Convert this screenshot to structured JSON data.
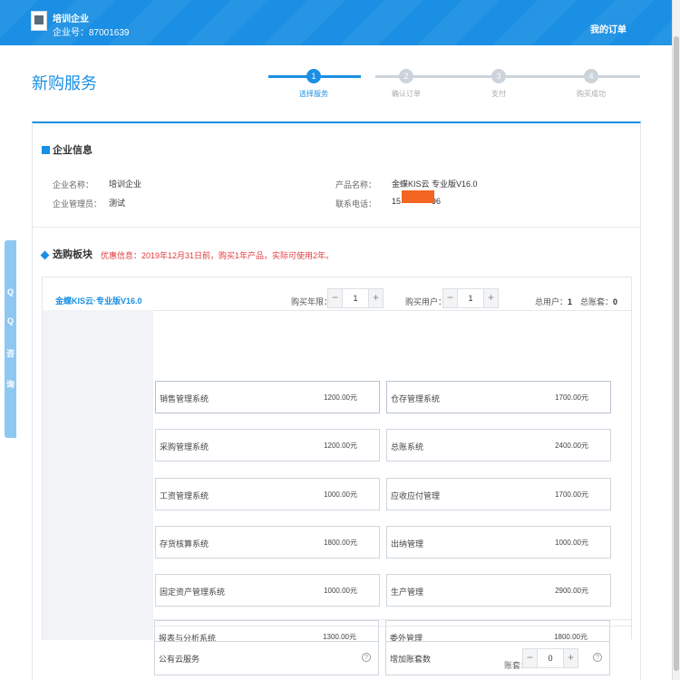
{
  "header": {
    "company_name": "培训企业",
    "company_no": "企业号：87001639",
    "my_orders": "我的订单"
  },
  "page": {
    "title": "新购服务"
  },
  "steps": [
    {
      "num": "1",
      "label": "选择服务",
      "active": true
    },
    {
      "num": "2",
      "label": "确认订单",
      "active": false
    },
    {
      "num": "3",
      "label": "支付",
      "active": false
    },
    {
      "num": "4",
      "label": "购买成功",
      "active": false
    }
  ],
  "enterprise_info": {
    "title": "企业信息",
    "name_label": "企业名称：",
    "name_value": "培训企业",
    "admin_label": "企业管理员：",
    "admin_value": "测试",
    "product_label": "产品名称：",
    "product_value": "金蝶KIS云 专业版V16.0",
    "phone_label": "联系电话：",
    "phone_prefix": "15",
    "phone_suffix": "96"
  },
  "modules": {
    "title": "选购板块",
    "promo": "优惠信息：2019年12月31日前，购买1年产品，实际可使用2年。",
    "product_tab": "金蝶KIS云·专业版V16.0",
    "years_label": "购买年限：",
    "years_value": "1",
    "users_label": "购买用户：",
    "users_value": "1",
    "total_users_label": "总用户：",
    "total_users_value": "1",
    "total_accounts_label": "总账套：",
    "total_accounts_value": "0",
    "minus": "−",
    "plus": "+",
    "items": [
      {
        "name": "销售管理系统",
        "price": "1200.00元"
      },
      {
        "name": "仓存管理系统",
        "price": "1700.00元"
      },
      {
        "name": "采购管理系统",
        "price": "1200.00元"
      },
      {
        "name": "总账系统",
        "price": "2400.00元"
      },
      {
        "name": "工资管理系统",
        "price": "1000.00元"
      },
      {
        "name": "应收应付管理",
        "price": "1700.00元"
      },
      {
        "name": "存货核算系统",
        "price": "1800.00元"
      },
      {
        "name": "出纳管理",
        "price": "1000.00元"
      },
      {
        "name": "固定资产管理系统",
        "price": "1000.00元"
      },
      {
        "name": "生产管理",
        "price": "2900.00元"
      },
      {
        "name": "报表与分析系统",
        "price": "1300.00元"
      },
      {
        "name": "委外管理",
        "price": "1800.00元"
      }
    ],
    "extras": {
      "cloud_service": "公有云服务",
      "add_accounts": "增加账套数",
      "accounts_label": "账套：",
      "accounts_value": "0",
      "help": "?"
    }
  },
  "qq_consult": [
    "Q",
    "Q",
    "咨",
    "询"
  ],
  "colors": {
    "brand": "#1a8fe3",
    "promo": "#e4393c",
    "redaction": "#f26522"
  }
}
